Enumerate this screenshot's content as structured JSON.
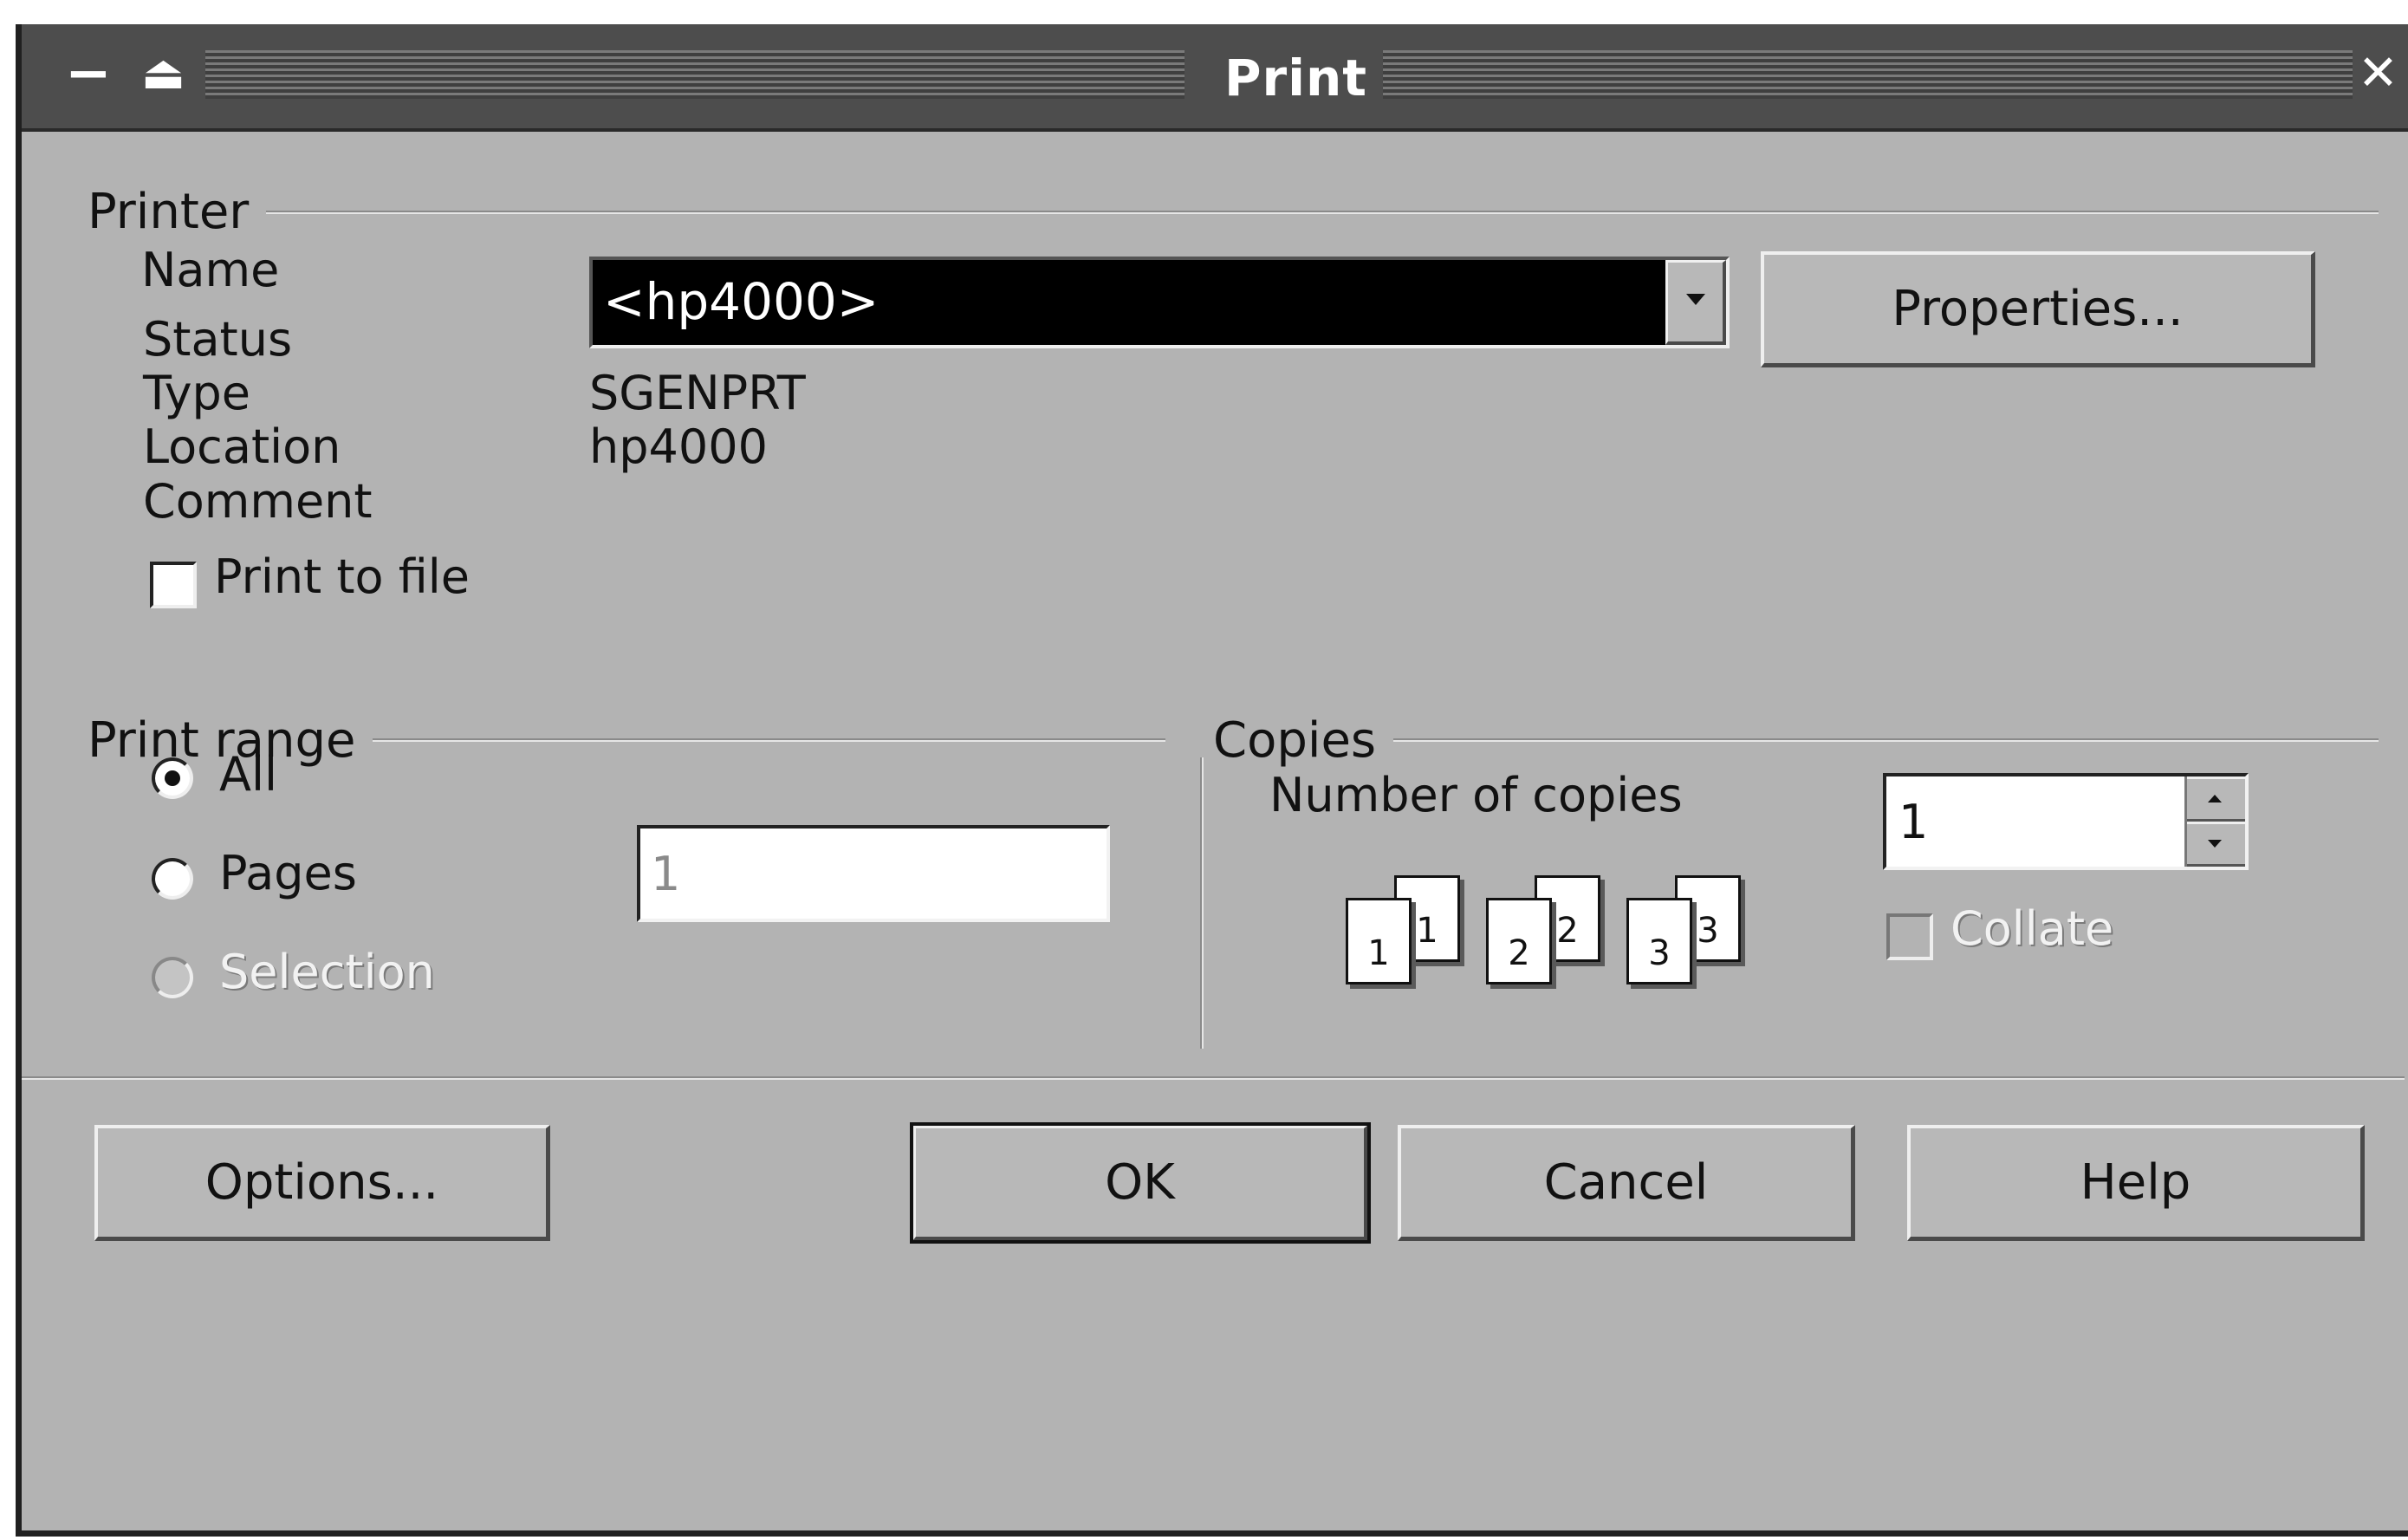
{
  "window": {
    "title": "Print",
    "minimize_glyph": "−",
    "shade_glyph": "⏏",
    "close_glyph": "✕"
  },
  "printer": {
    "group_label": "Printer",
    "name_label": "Name",
    "name_value": "<hp4000>",
    "properties_button": "Properties...",
    "status_label": "Status",
    "status_value": "",
    "type_label": "Type",
    "type_value": "SGENPRT",
    "location_label": "Location",
    "location_value": "hp4000",
    "comment_label": "Comment",
    "comment_value": "",
    "print_to_file_label": "Print to file",
    "print_to_file_checked": false
  },
  "print_range": {
    "group_label": "Print range",
    "options": [
      {
        "label": "All",
        "checked": true,
        "enabled": true
      },
      {
        "label": "Pages",
        "checked": false,
        "enabled": true
      },
      {
        "label": "Selection",
        "checked": false,
        "enabled": false
      }
    ],
    "pages_value": "1"
  },
  "copies": {
    "group_label": "Copies",
    "number_label": "Number of copies",
    "number_value": "1",
    "collate_label": "Collate",
    "collate_checked": false,
    "collate_enabled": false,
    "collate_pages": [
      "1",
      "1",
      "2",
      "2",
      "3",
      "3"
    ]
  },
  "buttons": {
    "options": "Options...",
    "ok": "OK",
    "cancel": "Cancel",
    "help": "Help"
  },
  "icons": [
    "minimize-icon",
    "shade-icon",
    "close-icon",
    "dropdown-arrow-icon",
    "spin-up-icon",
    "spin-down-icon",
    "collate-pages-icon"
  ]
}
